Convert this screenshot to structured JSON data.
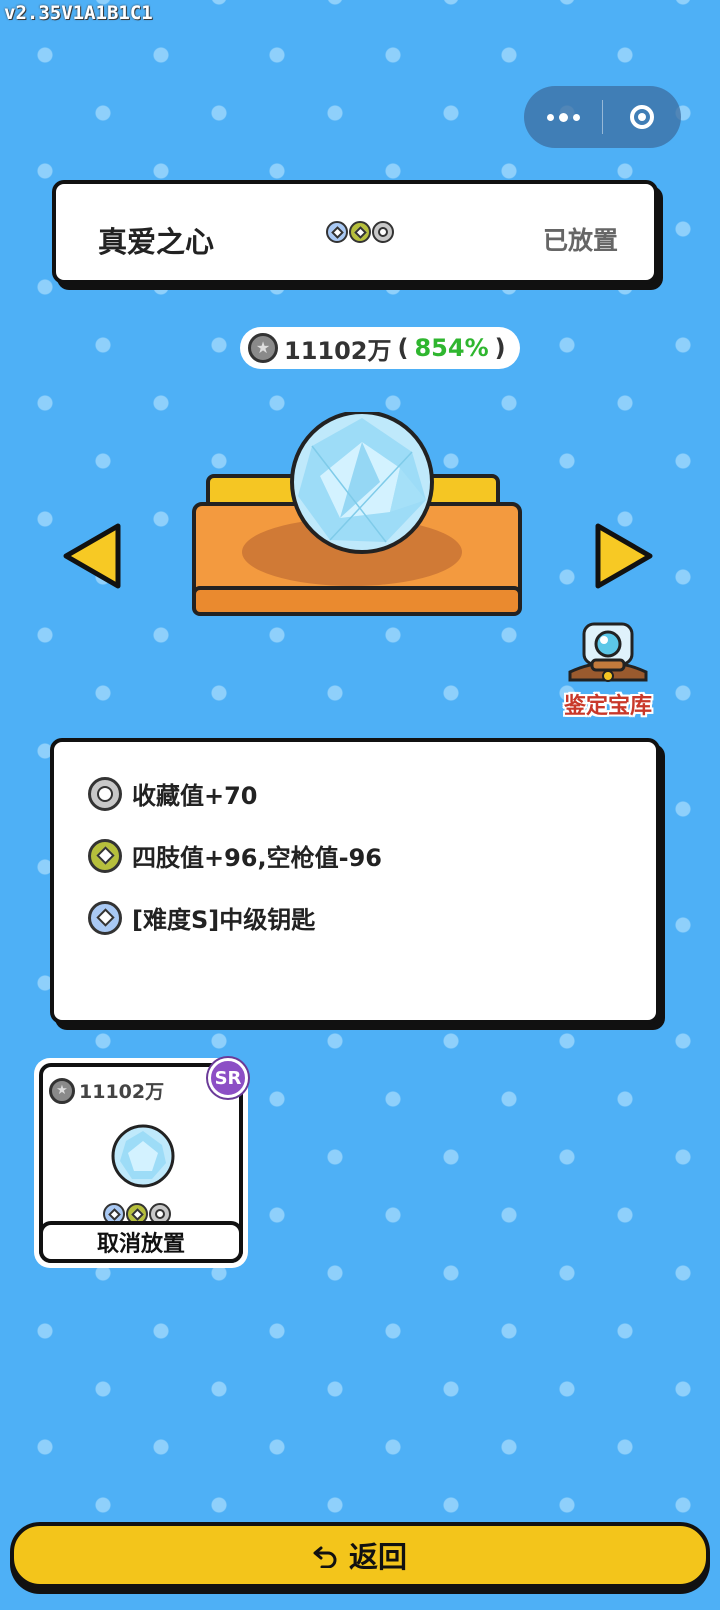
{
  "version": "v2.35V1A1B1C1",
  "title_card": {
    "name": "真爱之心",
    "status": "已放置"
  },
  "value": {
    "amount": "11102万",
    "percent_open": "(",
    "percent": "854%",
    "percent_close": ")"
  },
  "vault": {
    "label": "鉴定宝库"
  },
  "attributes": [
    {
      "text": "收藏值+70",
      "badge": "gray-circle"
    },
    {
      "text": "四肢值+96,空枪值-96",
      "badge": "olive-diamond"
    },
    {
      "text": "[难度S]中级钥匙",
      "badge": "blue-diamond"
    }
  ],
  "slot": {
    "value": "11102万",
    "rarity": "SR",
    "button": "取消放置"
  },
  "back_button": {
    "label": "返回"
  },
  "colors": {
    "background": "#4eb0f6",
    "back_button": "#f3c51b",
    "percent_green": "#2fb62f",
    "rarity_purple": "#8c4fc5"
  }
}
